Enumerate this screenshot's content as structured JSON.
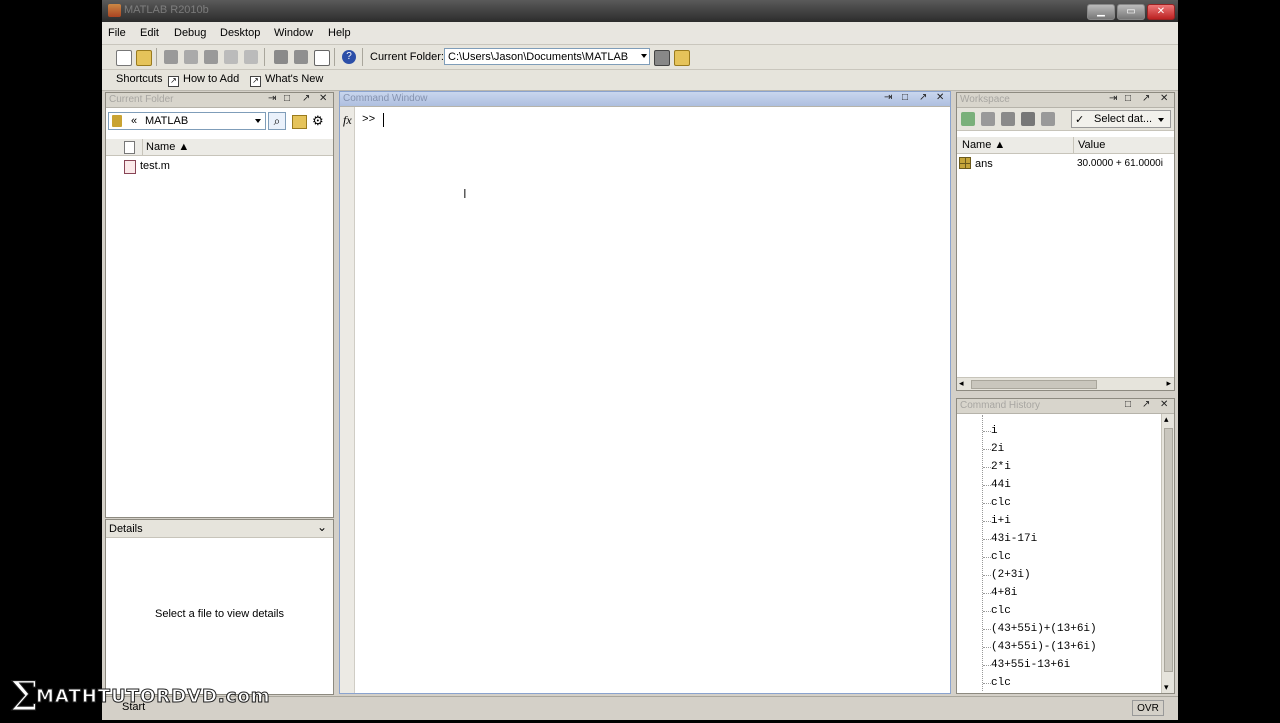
{
  "window": {
    "title": "MATLAB R2010b"
  },
  "menu": [
    "File",
    "Edit",
    "Debug",
    "Desktop",
    "Window",
    "Help"
  ],
  "toolbar": {
    "current_folder_label": "Current Folder:",
    "current_folder_path": "C:\\Users\\Jason\\Documents\\MATLAB"
  },
  "shortcuts": {
    "label": "Shortcuts",
    "how_to_add": "How to Add",
    "whats_new": "What's New"
  },
  "current_folder_panel": {
    "title": "Current Folder",
    "path_crumb": "«",
    "path_name": "MATLAB",
    "column_name": "Name ▲",
    "files": [
      "test.m"
    ]
  },
  "details_panel": {
    "title": "Details",
    "message": "Select a file to view details"
  },
  "command_window": {
    "title": "Command Window",
    "fx_label": "fx",
    "prompt": ">>"
  },
  "workspace_panel": {
    "title": "Workspace",
    "select_data_label": "Select dat...",
    "columns": {
      "name": "Name ▲",
      "value": "Value"
    },
    "variables": [
      {
        "name": "ans",
        "value": "30.0000 + 61.0000i"
      }
    ]
  },
  "history_panel": {
    "title": "Command History",
    "items": [
      "i",
      "2i",
      "2*i",
      "44i",
      "clc",
      "i+i",
      "43i-17i",
      "clc",
      "(2+3i)",
      "4+8i",
      "clc",
      "(43+55i)+(13+6i)",
      "(43+55i)-(13+6i)",
      "43+55i-13+6i",
      "clc"
    ]
  },
  "status": {
    "start": "Start",
    "ovr": "OVR"
  },
  "logo": {
    "brand": "MATHTUTORDVD.com"
  },
  "colors": {
    "accent": "#aebfdf",
    "chrome": "#d4d0c8"
  }
}
